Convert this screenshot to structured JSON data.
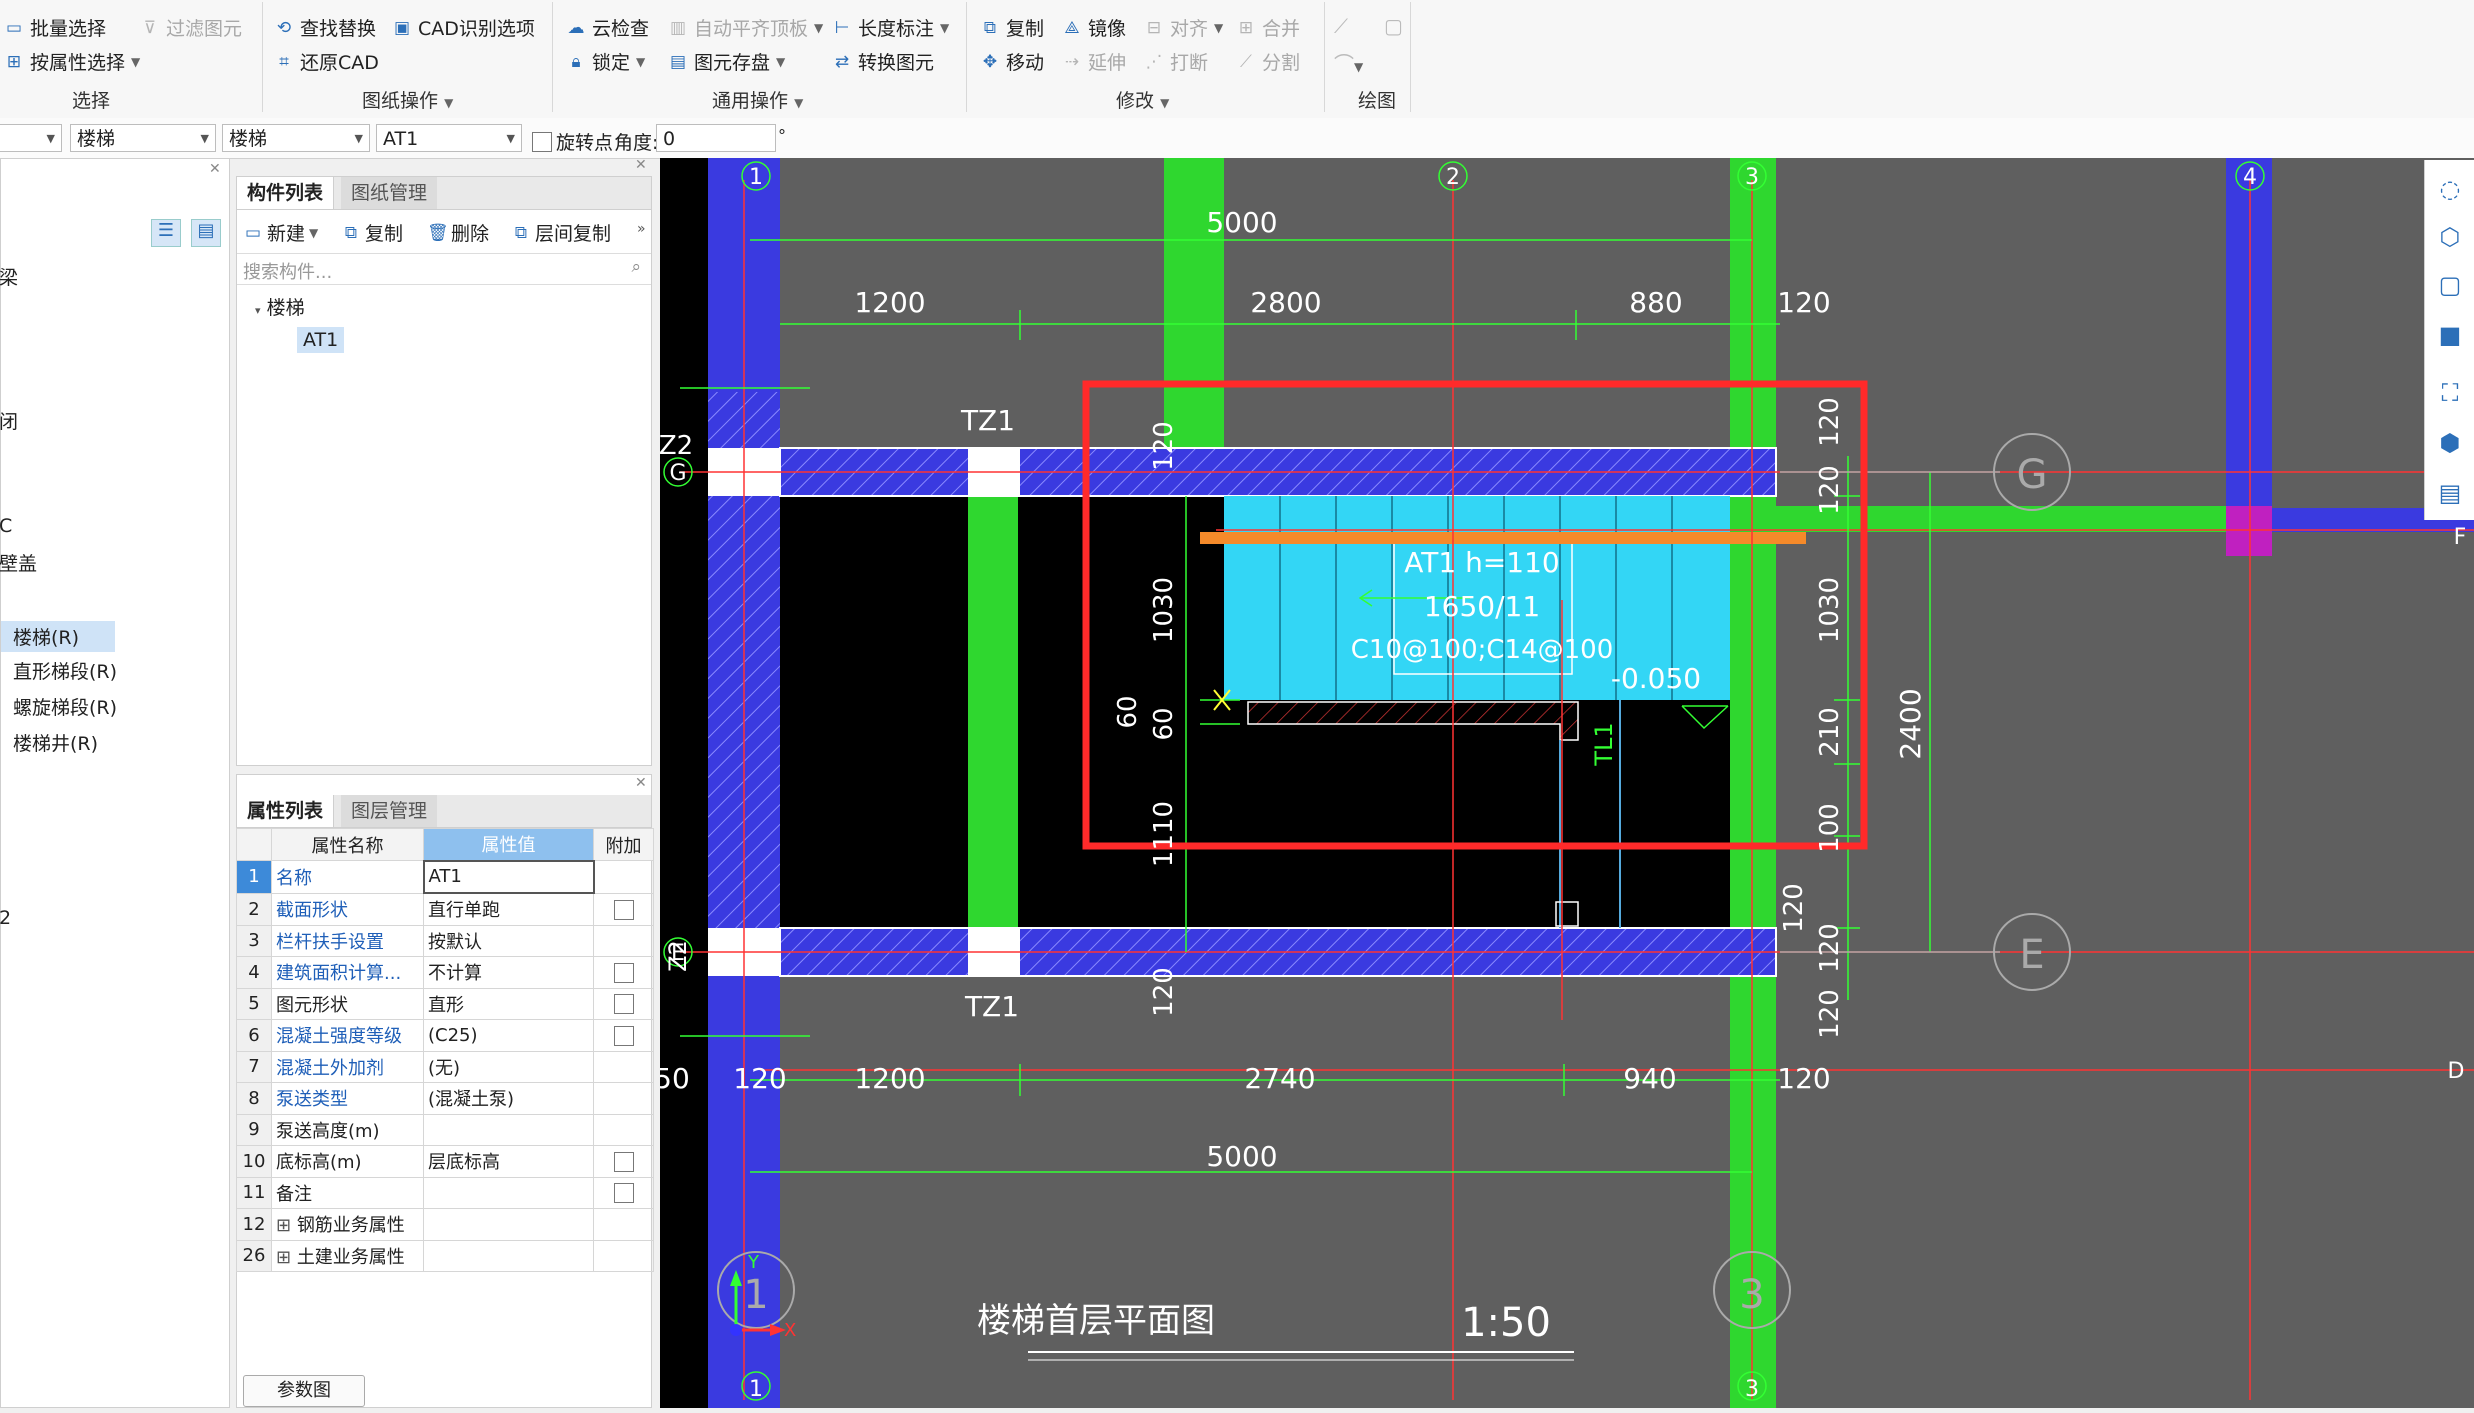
{
  "ribbon": {
    "select_group": {
      "batch_select": "批量选择",
      "filter_elements": "过滤图元",
      "select_by_attr": "按属性选择",
      "label": "选择"
    },
    "drawing_ops": {
      "find_replace": "查找替换",
      "cad_options": "CAD识别选项",
      "restore_cad": "还原CAD",
      "label": "图纸操作"
    },
    "general_ops": {
      "cloud_check": "云检查",
      "auto_align_slab": "自动平齐顶板",
      "length_dim": "长度标注",
      "lock": "锁定",
      "element_storage": "图元存盘",
      "convert_element": "转换图元",
      "label": "通用操作"
    },
    "modify": {
      "copy": "复制",
      "mirror": "镜像",
      "align": "对齐",
      "merge": "合并",
      "move": "移动",
      "extend": "延伸",
      "break": "打断",
      "split": "分割",
      "label": "修改"
    },
    "draw": {
      "label": "绘图"
    }
  },
  "toolbar2": {
    "combo1": "楼梯",
    "combo2": "楼梯",
    "combo3": "AT1",
    "rotate_point": "旋转点",
    "angle_label": "角度:",
    "angle_value": "0",
    "degree": "°"
  },
  "nav_tree": {
    "items": [
      "楼梯(R)",
      "直形梯段(R)",
      "螺旋梯段(R)",
      "楼梯井(R)"
    ],
    "partial_labels": [
      "梁",
      "闭",
      "C",
      "壁盖",
      "2"
    ]
  },
  "component_panel": {
    "tabs": [
      "构件列表",
      "图纸管理"
    ],
    "tools": {
      "new": "新建",
      "copy": "复制",
      "delete": "删除",
      "floor_copy": "层间复制"
    },
    "search_placeholder": "搜索构件...",
    "tree_root": "楼梯",
    "tree_child": "AT1"
  },
  "property_panel": {
    "tabs": [
      "属性列表",
      "图层管理"
    ],
    "headers": {
      "name": "属性名称",
      "value": "属性值",
      "extra": "附加"
    },
    "rows": [
      {
        "idx": "1",
        "name": "名称",
        "value": "AT1",
        "blue": true,
        "check": false
      },
      {
        "idx": "2",
        "name": "截面形状",
        "value": "直行单跑",
        "blue": true,
        "check": true
      },
      {
        "idx": "3",
        "name": "栏杆扶手设置",
        "value": "按默认",
        "blue": true,
        "check": false
      },
      {
        "idx": "4",
        "name": "建筑面积计算...",
        "value": "不计算",
        "blue": true,
        "check": true
      },
      {
        "idx": "5",
        "name": "图元形状",
        "value": "直形",
        "blue": false,
        "check": true
      },
      {
        "idx": "6",
        "name": "混凝土强度等级",
        "value": "(C25)",
        "blue": true,
        "check": true
      },
      {
        "idx": "7",
        "name": "混凝土外加剂",
        "value": "(无)",
        "blue": true,
        "check": false
      },
      {
        "idx": "8",
        "name": "泵送类型",
        "value": "(混凝土泵)",
        "blue": true,
        "check": false
      },
      {
        "idx": "9",
        "name": "泵送高度(m)",
        "value": "",
        "blue": false,
        "check": false
      },
      {
        "idx": "10",
        "name": "底标高(m)",
        "value": "层底标高",
        "blue": false,
        "check": true
      },
      {
        "idx": "11",
        "name": "备注",
        "value": "",
        "blue": false,
        "check": true
      },
      {
        "idx": "12",
        "name": "钢筋业务属性",
        "value": "",
        "blue": false,
        "check": false,
        "expand": true
      },
      {
        "idx": "26",
        "name": "土建业务属性",
        "value": "",
        "blue": false,
        "check": false,
        "expand": true
      }
    ],
    "param_button": "参数图"
  },
  "drawing": {
    "axis_labels": {
      "a1": "1",
      "a2": "2",
      "a3": "3",
      "a4": "4",
      "g": "G",
      "e": "E",
      "f": "F",
      "d": "D"
    },
    "dims_top": {
      "total": "5000",
      "d1": "1200",
      "d2": "2800",
      "d3": "880",
      "d4": "120"
    },
    "dims_bottom": {
      "total": "5000",
      "d0": "120",
      "d1": "1200",
      "d2": "2740",
      "d3": "940",
      "d4": "120"
    },
    "dims_left": {
      "d1": "1030",
      "d2": "60",
      "d3": "60",
      "d4": "1110",
      "d5": "120",
      "d6": "120"
    },
    "dims_right": {
      "r1": "120",
      "r2": "120",
      "r3": "1030",
      "r4": "210",
      "r5": "100",
      "r6": "120",
      "r7": "120",
      "r8": "120",
      "total": "2400"
    },
    "labels": {
      "tz1_top": "TZ1",
      "tz1_bottom": "TZ1",
      "tl1": "TL1",
      "z2_top": "Z2",
      "z2_bottom": "Z2",
      "left50": "50"
    },
    "stair_text": [
      "AT1 h=110",
      "1650/11",
      "C10@100;C14@100"
    ],
    "elevation": "-0.050",
    "plan_title": "楼梯首层平面图",
    "scale": "1:50",
    "ucs_y": "Y",
    "ucs_x": "X"
  }
}
